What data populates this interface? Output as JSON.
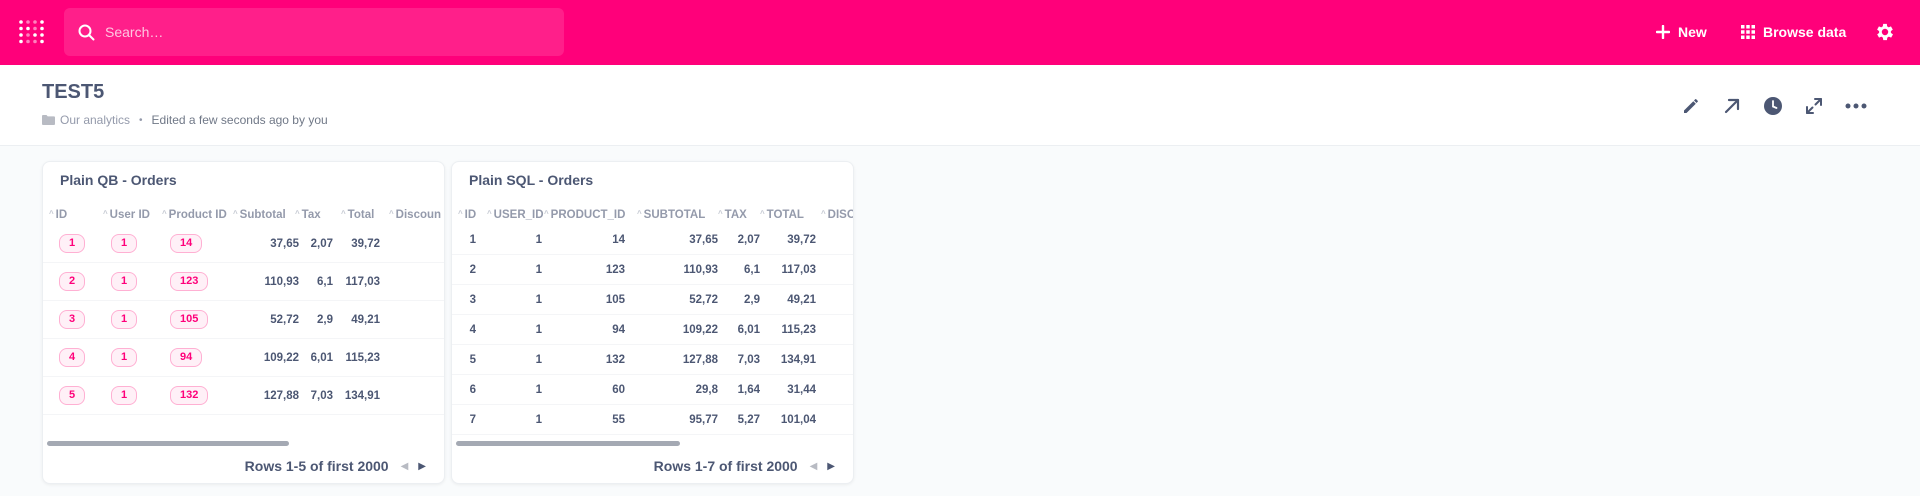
{
  "nav": {
    "search_placeholder": "Search…",
    "new_label": "New",
    "browse_label": "Browse data",
    "brand_color": "#ff007a"
  },
  "dashboard": {
    "title": "TEST5",
    "collection": "Our analytics",
    "edited": "Edited a few seconds ago by you",
    "actions": [
      "pencil-icon",
      "share-arrow-icon",
      "history-clock-icon",
      "fullscreen-icon",
      "more-icon"
    ]
  },
  "cards": [
    {
      "title": "Plain QB - Orders",
      "columns": [
        "ID",
        "User ID",
        "Product ID",
        "Subtotal",
        "Tax",
        "Total",
        "Discoun"
      ],
      "rows": [
        [
          "1",
          "1",
          "14",
          "37,65",
          "2,07",
          "39,72"
        ],
        [
          "2",
          "1",
          "123",
          "110,93",
          "6,1",
          "117,03"
        ],
        [
          "3",
          "1",
          "105",
          "52,72",
          "2,9",
          "49,21"
        ],
        [
          "4",
          "1",
          "94",
          "109,22",
          "6,01",
          "115,23"
        ],
        [
          "5",
          "1",
          "132",
          "127,88",
          "7,03",
          "134,91"
        ]
      ],
      "footer": "Rows 1-5 of first 2000"
    },
    {
      "title": "Plain SQL - Orders",
      "columns": [
        "ID",
        "USER_ID",
        "PRODUCT_ID",
        "SUBTOTAL",
        "TAX",
        "TOTAL",
        "DISC"
      ],
      "rows": [
        [
          "1",
          "1",
          "14",
          "37,65",
          "2,07",
          "39,72"
        ],
        [
          "2",
          "1",
          "123",
          "110,93",
          "6,1",
          "117,03"
        ],
        [
          "3",
          "1",
          "105",
          "52,72",
          "2,9",
          "49,21"
        ],
        [
          "4",
          "1",
          "94",
          "109,22",
          "6,01",
          "115,23"
        ],
        [
          "5",
          "1",
          "132",
          "127,88",
          "7,03",
          "134,91"
        ],
        [
          "6",
          "1",
          "60",
          "29,8",
          "1,64",
          "31,44"
        ],
        [
          "7",
          "1",
          "55",
          "95,77",
          "5,27",
          "101,04"
        ]
      ],
      "footer": "Rows 1-7 of first 2000"
    }
  ]
}
